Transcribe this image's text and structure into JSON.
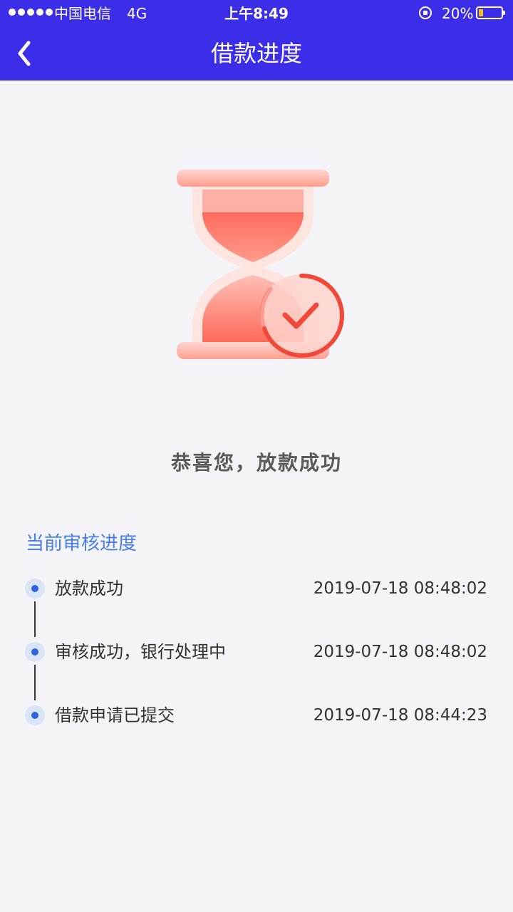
{
  "status_bar": {
    "carrier": "中国电信",
    "network": "4G",
    "time": "上午8:49",
    "battery_percent": "20%",
    "battery_level": 0.2,
    "battery_color": "#f7c11a"
  },
  "nav": {
    "title": "借款进度",
    "back_icon": "chevron-left-icon",
    "bar_color": "#3c2de9"
  },
  "illustration": {
    "icon": "hourglass-check-icon"
  },
  "result": {
    "title": "恭喜您，放款成功"
  },
  "progress": {
    "heading": "当前审核进度",
    "steps": [
      {
        "label": "放款成功",
        "time": "2019-07-18 08:48:02"
      },
      {
        "label": "审核成功，银行处理中",
        "time": "2019-07-18 08:48:02"
      },
      {
        "label": "借款申请已提交",
        "time": "2019-07-18 08:44:23"
      }
    ]
  }
}
